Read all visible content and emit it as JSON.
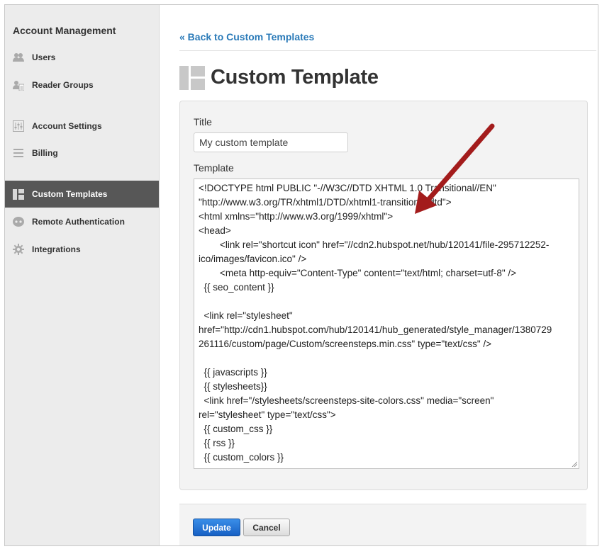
{
  "sidebar": {
    "heading": "Account Management",
    "items": [
      {
        "label": "Users",
        "icon": "users-icon"
      },
      {
        "label": "Reader Groups",
        "icon": "reader-groups-icon"
      },
      {
        "label": "Account Settings",
        "icon": "sliders-icon"
      },
      {
        "label": "Billing",
        "icon": "list-icon"
      },
      {
        "label": "Custom Templates",
        "icon": "layout-icon",
        "active": true
      },
      {
        "label": "Remote Authentication",
        "icon": "remote-auth-icon"
      },
      {
        "label": "Integrations",
        "icon": "gear-icon"
      }
    ]
  },
  "main": {
    "back_link": "« Back to Custom Templates",
    "page_title": "Custom Template",
    "title_label": "Title",
    "title_value": "My custom template",
    "template_label": "Template",
    "template_lines": [
      "<!DOCTYPE html PUBLIC \"-//W3C//DTD XHTML 1.0 Transitional//EN\"",
      "\"http://www.w3.org/TR/xhtml1/DTD/xhtml1-transitional.dtd\">",
      "<html xmlns=\"http://www.w3.org/1999/xhtml\">",
      "<head>",
      "        <link rel=\"shortcut icon\" href=\"//cdn2.hubspot.net/hub/120141/file-295712252-",
      "ico/images/favicon.ico\" />",
      "        <meta http-equiv=\"Content-Type\" content=\"text/html; charset=utf-8\" />",
      "  {{ seo_content }}",
      "",
      "  <link rel=\"stylesheet\"",
      "href=\"http://cdn1.hubspot.com/hub/120141/hub_generated/style_manager/1380729",
      "261116/custom/page/Custom/screensteps.min.css\" type=\"text/css\" />",
      "",
      "  {{ javascripts }}",
      "  {{ stylesheets}}",
      "  <link href=\"/stylesheets/screensteps-site-colors.css\" media=\"screen\"",
      "rel=\"stylesheet\" type=\"text/css\">",
      "  {{ custom_css }}",
      "  {{ rss }}",
      "  {{ custom_colors }}"
    ],
    "update_label": "Update",
    "cancel_label": "Cancel"
  },
  "colors": {
    "link": "#2a7ab8",
    "sidebar_bg": "#ececec",
    "sidebar_active": "#575757",
    "primary_button": "#1f6fd1",
    "annotation_arrow": "#a31c1c"
  }
}
